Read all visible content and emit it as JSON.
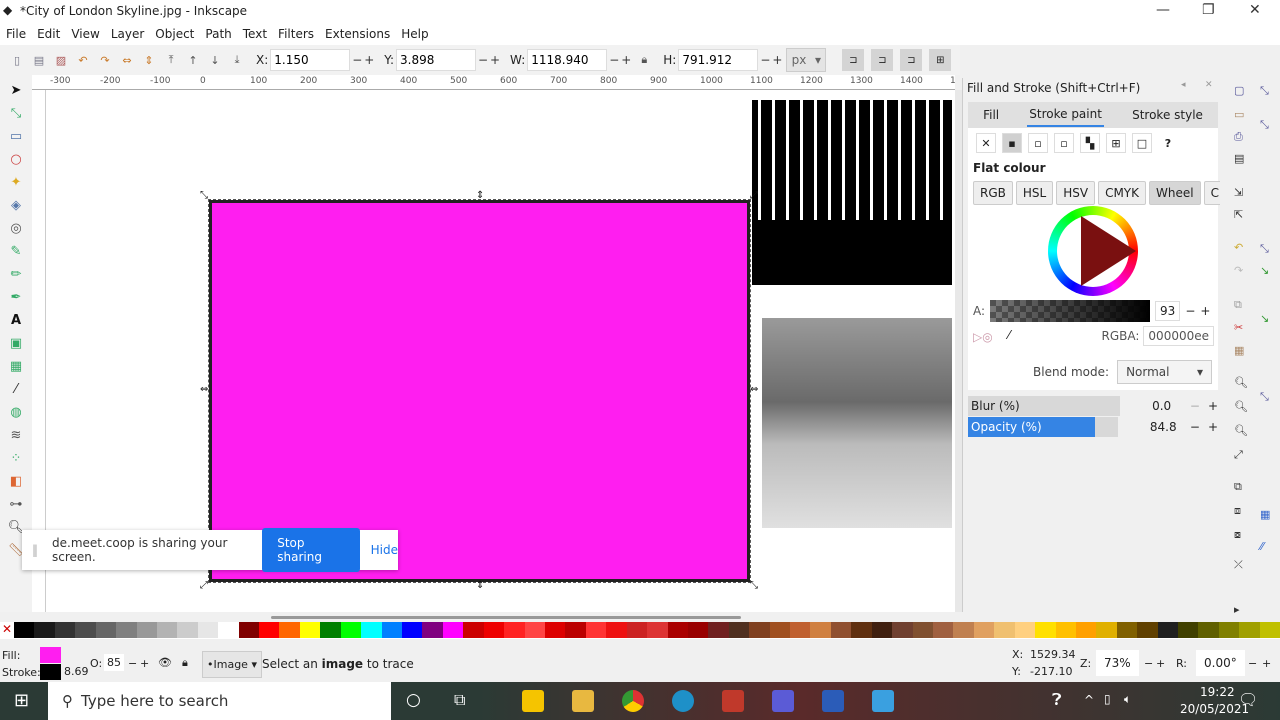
{
  "window": {
    "title": "*City of London Skyline.jpg - Inkscape"
  },
  "menu": [
    "File",
    "Edit",
    "View",
    "Layer",
    "Object",
    "Path",
    "Text",
    "Filters",
    "Extensions",
    "Help"
  ],
  "toolbar": {
    "x_label": "X:",
    "x": "1.150",
    "y_label": "Y:",
    "y": "3.898",
    "w_label": "W:",
    "w": "1118.940",
    "h_label": "H:",
    "h": "791.912",
    "unit": "px"
  },
  "ruler": [
    "-300",
    "-200",
    "-100",
    "0",
    "100",
    "200",
    "300",
    "400",
    "500",
    "600",
    "700",
    "800",
    "900",
    "1000",
    "1100",
    "1200",
    "1300",
    "1400",
    "150"
  ],
  "share": {
    "message": "de.meet.coop is sharing your screen.",
    "stop": "Stop sharing",
    "hide": "Hide"
  },
  "panel": {
    "title": "Fill and Stroke (Shift+Ctrl+F)",
    "tabs": [
      "Fill",
      "Stroke paint",
      "Stroke style"
    ],
    "active_tab": "Stroke paint",
    "heading": "Flat colour",
    "modes": [
      "RGB",
      "HSL",
      "HSV",
      "CMYK",
      "Wheel",
      "CMS"
    ],
    "active_mode": "Wheel",
    "alpha_label": "A:",
    "alpha": "93",
    "rgba_label": "RGBA:",
    "rgba": "000000ee",
    "blend_label": "Blend mode:",
    "blend": "Normal",
    "blur_label": "Blur (%)",
    "blur": "0.0",
    "opacity_label": "Opacity (%)",
    "opacity": "84.8",
    "opacity_fraction": 0.848
  },
  "colors": {
    "fill": "#ff1ef0",
    "stroke": "#000000",
    "accent": "#3584e4"
  },
  "palette": [
    "#000",
    "#1a1a1a",
    "#333",
    "#4d4d4d",
    "#666",
    "#808080",
    "#999",
    "#b3b3b3",
    "#ccc",
    "#e6e6e6",
    "#fff",
    "#800000",
    "#f00",
    "#ff6600",
    "#ff0",
    "#008000",
    "#0f0",
    "#0ff",
    "#0080ff",
    "#00f",
    "#800080",
    "#f0f",
    "#c00",
    "#e00",
    "#f22",
    "#f44",
    "#d00",
    "#b00",
    "#f33",
    "#e11",
    "#c22",
    "#d33",
    "#a00",
    "#900",
    "#702020",
    "#503020",
    "#804020",
    "#a05020",
    "#c06030",
    "#d08040",
    "#905030",
    "#603010",
    "#402010",
    "#704030",
    "#805030",
    "#a06040",
    "#c08050",
    "#e0a060",
    "#f0c070",
    "#ffd080",
    "#ffe000",
    "#ffc000",
    "#ffa000",
    "#e0b000",
    "#806000",
    "#604000",
    "#202020",
    "#404000",
    "#606000",
    "#808000",
    "#a0a000",
    "#c0c000"
  ],
  "status": {
    "fill_label": "Fill:",
    "stroke_label": "Stroke:",
    "stroke_width": "8.69",
    "opacity_label": "O:",
    "opacity": "85",
    "layer": "•Image",
    "message_pre": "Select an ",
    "message_bold": "image",
    "message_post": " to trace",
    "cx_label": "X:",
    "cx": "1529.34",
    "cy_label": "Y:",
    "cy": "-217.10",
    "zoom_label": "Z:",
    "zoom": "73%",
    "rot_label": "R:",
    "rotation": "0.00°"
  },
  "taskbar": {
    "search_placeholder": "Type here to search",
    "time": "19:22",
    "date": "20/05/2021"
  }
}
